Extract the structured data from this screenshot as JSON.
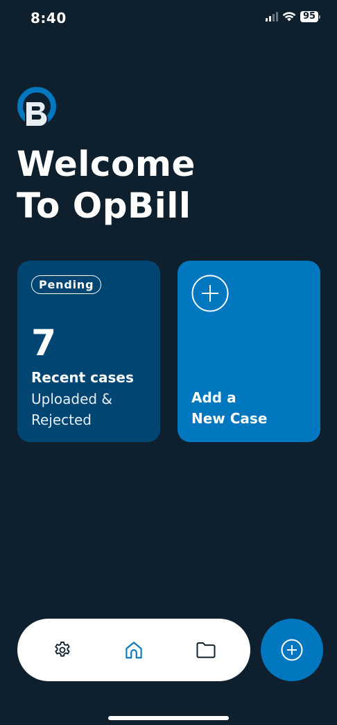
{
  "status_bar": {
    "time": "8:40",
    "battery": "95",
    "icons": [
      "signal-icon",
      "wifi-icon",
      "battery-icon"
    ]
  },
  "brand": {
    "logo_letter": "B",
    "colors": {
      "background": "#0e1f2e",
      "card_pending": "#014673",
      "accent": "#0077be",
      "logo_ring": "#0077be"
    }
  },
  "welcome": {
    "line1": "Welcome",
    "line2": "To OpBill"
  },
  "cards": {
    "pending": {
      "badge": "Pending",
      "count": "7",
      "label": "Recent cases",
      "sub": "Uploaded & Rejected"
    },
    "add_case": {
      "icon": "plus-circle-icon",
      "line1": "Add a",
      "line2": "New Case"
    }
  },
  "bottom_nav": {
    "items": [
      {
        "icon": "gear-icon",
        "name": "settings"
      },
      {
        "icon": "home-icon",
        "name": "home",
        "active": true
      },
      {
        "icon": "folder-icon",
        "name": "folder"
      }
    ],
    "fab_icon": "plus-circle-icon"
  }
}
